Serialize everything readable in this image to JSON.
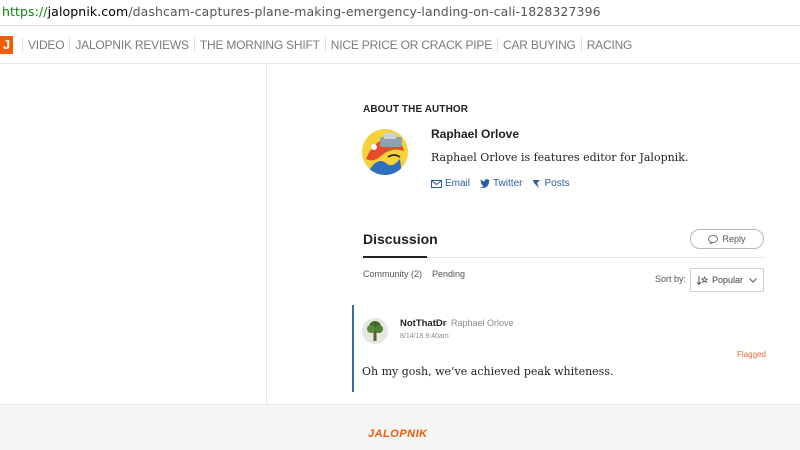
{
  "browser": {
    "url_scheme": "https://",
    "url_host": "jalopnik.com",
    "url_path": "/dashcam-captures-plane-making-emergency-landing-on-cali-1828327396"
  },
  "nav": {
    "logo_letter": "J",
    "items": [
      "VIDEO",
      "JALOPNIK REVIEWS",
      "THE MORNING SHIFT",
      "NICE PRICE OR CRACK PIPE",
      "CAR BUYING",
      "RACING"
    ]
  },
  "author": {
    "section_title": "ABOUT THE AUTHOR",
    "name": "Raphael Orlove",
    "bio": "Raphael Orlove is features editor for Jalopnik.",
    "links": {
      "email": "Email",
      "twitter": "Twitter",
      "posts": "Posts"
    }
  },
  "discussion": {
    "title": "Discussion",
    "reply_label": "Reply",
    "tabs": [
      "Community (2)",
      "Pending"
    ],
    "sort_label": "Sort by:",
    "sort_value": "Popular"
  },
  "comment": {
    "author": "NotThatDr",
    "reply_to": "Raphael Orlove",
    "time": "8/14/18 9:40am",
    "flag": "Flagged",
    "text": "Oh my gosh, we’ve achieved peak whiteness."
  },
  "footer": {
    "logo": "JALOPNIK"
  },
  "colors": {
    "brand": "#f25c05",
    "link": "#2a5d9e",
    "thread_bar": "#3b6ea5",
    "flag": "#e8683c"
  }
}
